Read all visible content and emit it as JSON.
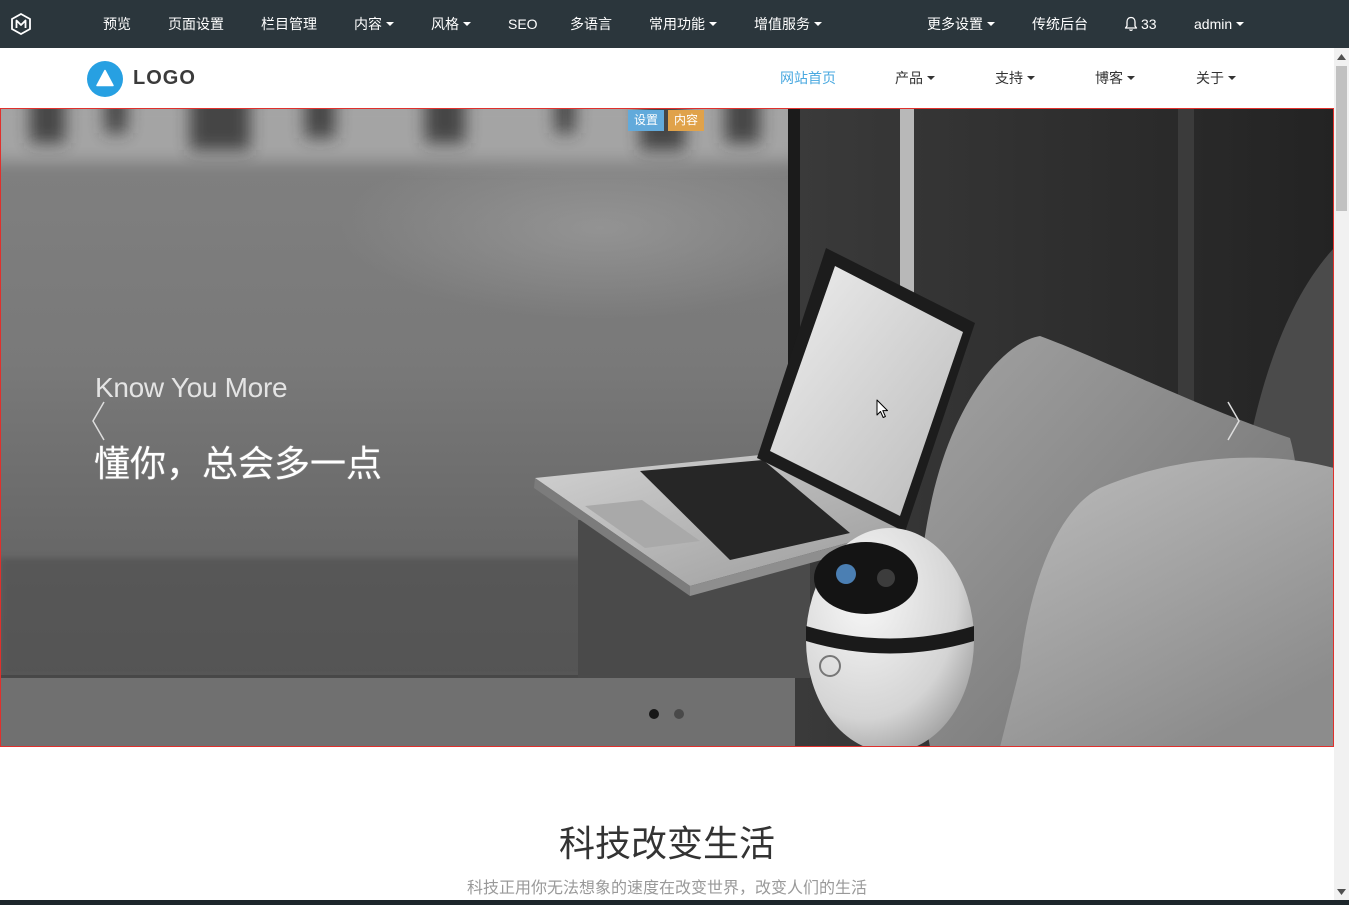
{
  "admin_bar": {
    "logo_icon": "metinfo-logo-icon",
    "background": "#2b363c",
    "items": [
      {
        "label": "预览",
        "dropdown": false
      },
      {
        "label": "页面设置",
        "dropdown": false
      },
      {
        "label": "栏目管理",
        "dropdown": false
      },
      {
        "label": "内容",
        "dropdown": true
      },
      {
        "label": "风格",
        "dropdown": true
      },
      {
        "label": "SEO",
        "dropdown": false
      },
      {
        "label": "多语言",
        "dropdown": false
      },
      {
        "label": "常用功能",
        "dropdown": true
      },
      {
        "label": "增值服务",
        "dropdown": true
      }
    ],
    "more_settings": {
      "label": "更多设置",
      "dropdown": true
    },
    "classic_backend": {
      "label": "传统后台"
    },
    "notifications": {
      "icon": "bell-icon",
      "count": "33"
    },
    "user": {
      "label": "admin",
      "dropdown": true
    }
  },
  "site_header": {
    "logo": {
      "icon": "triangle-in-circle-icon",
      "text": "LOGO",
      "color": "#27a0e2"
    },
    "active_color": "#4aa9e0",
    "nav": [
      {
        "label": "网站首页",
        "active": true,
        "dropdown": false
      },
      {
        "label": "产品",
        "active": false,
        "dropdown": true
      },
      {
        "label": "支持",
        "active": false,
        "dropdown": true
      },
      {
        "label": "博客",
        "active": false,
        "dropdown": true
      },
      {
        "label": "关于",
        "active": false,
        "dropdown": true
      }
    ]
  },
  "banner": {
    "border_color": "#e0302c",
    "edit_badges": [
      {
        "label": "设置",
        "color": "#62aadb"
      },
      {
        "label": "内容",
        "color": "#e0a24a"
      }
    ],
    "title": "Know You More",
    "subtitle": "懂你，总会多一点",
    "slide_count": 2,
    "active_slide": 1,
    "prev_icon": "chevron-left-icon",
    "next_icon": "chevron-right-icon"
  },
  "section": {
    "title": "科技改变生活",
    "subtitle": "科技正用你无法想象的速度在改变世界，改变人们的生活"
  }
}
